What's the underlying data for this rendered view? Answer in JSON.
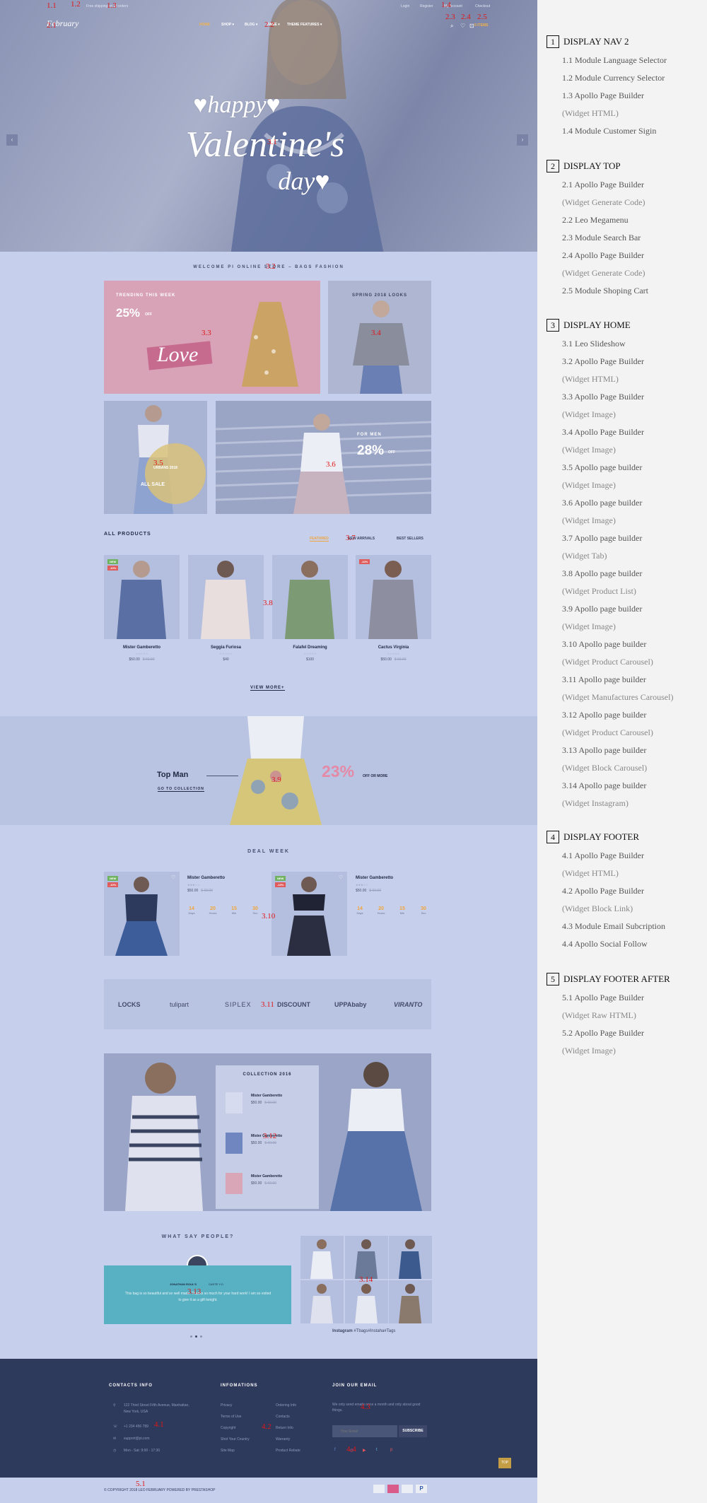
{
  "topbar": {
    "shipping": "Free shipping on all orders",
    "links": [
      "Login",
      "Register",
      "My Account",
      "Checkout"
    ]
  },
  "logo": "February",
  "nav": [
    {
      "label": "HOME",
      "active": true
    },
    {
      "label": "SHOP ▾",
      "active": false
    },
    {
      "label": "BLOG ▾",
      "active": false
    },
    {
      "label": "PAGE ▾",
      "active": false
    },
    {
      "label": "THEME FEATURES ▾",
      "active": false
    }
  ],
  "header_icons": [
    "search-icon",
    "heart-icon",
    "cart-icon"
  ],
  "cart_label": "0 ITEMS",
  "hero": {
    "line1": "♥happy♥",
    "line2": "Valentine's",
    "line3": "day♥",
    "prev": "‹",
    "next": "›"
  },
  "welcome": "WELCOME PI ONLINE STORE – BAGS FASHION",
  "banners": {
    "b1": {
      "kicker": "TRENDING THIS WEEK",
      "discount": "25%",
      "suffix": "OFF",
      "script": "Love"
    },
    "b2": {
      "kicker": "SPRING 2018 LOOKS"
    },
    "b3": {
      "line1": "URBANS 2018",
      "line2": "ALL SALE"
    },
    "b4": {
      "kicker": "FOR MEN",
      "discount": "28%",
      "suffix": "OFF"
    }
  },
  "products": {
    "title": "ALL PRODUCTS",
    "tabs": [
      {
        "label": "FEATURED",
        "active": true
      },
      {
        "label": "NEW ARRIVALS",
        "active": false
      },
      {
        "label": "BEST SELLERS",
        "active": false
      }
    ],
    "items": [
      {
        "name": "Mister Gamberetto",
        "price": "$50.00",
        "old": "$ 60.00",
        "badges": [
          "NEW",
          "-10%"
        ],
        "stars": "☆☆☆☆☆"
      },
      {
        "name": "Seggia Furiosa",
        "price": "$40",
        "old": "",
        "badges": [],
        "stars": "☆☆☆☆☆"
      },
      {
        "name": "Falafel Dreaming",
        "price": "$100",
        "old": "",
        "badges": [],
        "stars": "☆☆☆☆☆"
      },
      {
        "name": "Cactus Virginia",
        "price": "$50.00",
        "old": "$ 60.00",
        "badges": [
          "-10%"
        ],
        "stars": "☆☆☆☆☆"
      }
    ],
    "view_more": "VIEW MORE+"
  },
  "topman": {
    "title": "Top Man",
    "link": "GO TO COLLECTION",
    "discount": "23%",
    "suffix": "OFF OR MORE"
  },
  "deal": {
    "title": "DEAL WEEK",
    "items": [
      {
        "name": "Mister Gamberetto",
        "stars": "★★★☆☆",
        "price": "$50.00",
        "old": "$ 60.00",
        "badges": [
          "NEW",
          "-10%"
        ]
      },
      {
        "name": "Mister Gamberetto",
        "stars": "★★★☆☆",
        "price": "$50.00",
        "old": "$ 60.00",
        "badges": [
          "NEW",
          "-10%"
        ]
      }
    ],
    "countdown": [
      {
        "v": "14",
        "u": "Days"
      },
      {
        "v": "20",
        "u": "Hours"
      },
      {
        "v": "15",
        "u": "Min"
      },
      {
        "v": "30",
        "u": "Sec"
      }
    ]
  },
  "brands": [
    "LOCKS",
    "tulipart",
    "SIPLEX",
    "DISCOUNT",
    "UPPAbaby",
    "VIRANTO"
  ],
  "collection": {
    "title": "COLLECTION 2016",
    "items": [
      {
        "name": "Mister Gamberetto",
        "price": "$50.00",
        "old": "$ 60.00"
      },
      {
        "name": "Mister Gamberetto",
        "price": "$50.00",
        "old": "$ 60.00"
      },
      {
        "name": "Mister Gamberetto",
        "price": "$50.00",
        "old": "$ 60.00"
      }
    ]
  },
  "testimonial": {
    "title": "WHAT SAY PEOPLE?",
    "author": "JONATHAN ROUL'S",
    "role": "CASTE Y.O",
    "text": "This bag is so beautiful and so well made. Thanks so much for your hard work! I am so exited to give it as a gift tonight."
  },
  "instagram": {
    "label": "Instagram",
    "tags": "#Tbags#Instaha#Tags"
  },
  "footer": {
    "contact": {
      "title": "CONTACTS INFO",
      "address1": "122 Third Street Fifth Avenue, Manhattan,",
      "address2": "New York, USA",
      "phone": "+1 234 456 789",
      "email": "support@pi.com",
      "hours": "Mon - Sat: 9:00 - 17:30"
    },
    "info": {
      "title": "INFOMATIONS",
      "col1": [
        "Privacy",
        "Terms of Use",
        "Copyright",
        "Shot Your Country",
        "Site Map"
      ],
      "col2": [
        "Ordering Info",
        "Contacts",
        "Return Info",
        "Warranty",
        "Product Rebate"
      ]
    },
    "join": {
      "title": "JOIN OUR EMAIL",
      "text": "We only send emails once a month and only about good things.",
      "placeholder": "Your Email",
      "button": "SUBSCRIBE"
    },
    "top": "TOP"
  },
  "copyright": "© COPYRIGHT 2018 LEO FEBRUARY  POWERED BY PRESTASHOP",
  "annotations": [
    "1.1",
    "1.2",
    "1.3",
    "1.4",
    "2.1",
    "2.2",
    "2.3",
    "2.4",
    "2.5",
    "3.1",
    "3.2",
    "3.3",
    "3.4",
    "3.5",
    "3.6",
    "3.7",
    "3.8",
    "3.9",
    "3.10",
    "3.11",
    "3.12",
    "3.13",
    "3.14",
    "4.1",
    "4.2",
    "4.3",
    "4.4",
    "5.1"
  ],
  "legend": [
    {
      "num": "1",
      "title": "DISPLAY NAV 2",
      "items": [
        [
          "1.1 Module Language Selector"
        ],
        [
          "1.2 Module Currency Selector"
        ],
        [
          "1.3 Apollo Page Builder",
          "(Widget HTML)"
        ],
        [
          "1.4 Module Customer Sigin"
        ]
      ]
    },
    {
      "num": "2",
      "title": "DISPLAY TOP",
      "items": [
        [
          "2.1 Apollo Page Builder",
          "(Widget Generate Code)"
        ],
        [
          "2.2 Leo Megamenu"
        ],
        [
          "2.3 Module Search Bar"
        ],
        [
          "2.4  Apollo Page Builder",
          "(Widget Generate Code)"
        ],
        [
          "2.5 Module Shoping Cart"
        ]
      ]
    },
    {
      "num": "3",
      "title": "DISPLAY HOME",
      "items": [
        [
          "3.1 Leo Slideshow"
        ],
        [
          "3.2  Apollo Page Builder",
          "(Widget HTML)"
        ],
        [
          "3.3  Apollo Page Builder",
          "(Widget Image)"
        ],
        [
          "3.4 Apollo Page Builder",
          "(Widget Image)"
        ],
        [
          "3.5 Apollo page builder",
          "(Widget Image)"
        ],
        [
          "3.6 Apollo page builder",
          "(Widget Image)"
        ],
        [
          "3.7 Apollo page builder",
          "(Widget Tab)"
        ],
        [
          "3.8 Apollo page builder",
          "(Widget Product List)"
        ],
        [
          "3.9 Apollo page builder",
          "(Widget Image)"
        ],
        [
          "3.10 Apollo page builder",
          "(Widget Product Carousel)"
        ],
        [
          "3.11 Apollo page builder",
          "(Widget Manufactures Carousel)"
        ],
        [
          "3.12 Apollo page builder",
          "(Widget Product Carousel)"
        ],
        [
          "3.13 Apollo page builder",
          "(Widget Block Carousel)"
        ],
        [
          "3.14 Apollo page builder",
          "(Widget Instagram)"
        ]
      ]
    },
    {
      "num": "4",
      "title": "DISPLAY FOOTER",
      "items": [
        [
          "4.1 Apollo Page Builder",
          "(Widget HTML)"
        ],
        [
          "4.2 Apollo Page Builder",
          "(Widget Block Link)"
        ],
        [
          "4.3 Module Email Subcription"
        ],
        [
          "4.4 Apollo Social Follow"
        ]
      ]
    },
    {
      "num": "5",
      "title": "DISPLAY FOOTER AFTER",
      "items": [
        [
          "5.1 Apollo Page Builder",
          "(Widget Raw HTML)"
        ],
        [
          "5.2 Apollo Page Builder",
          "(Widget Image)"
        ]
      ]
    }
  ]
}
